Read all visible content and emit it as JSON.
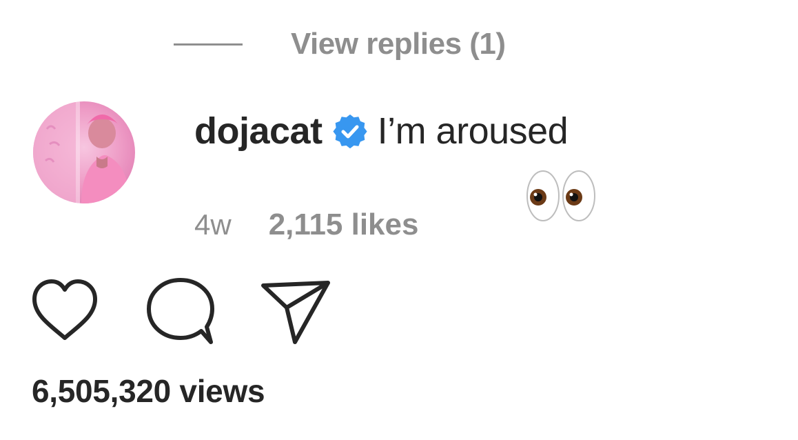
{
  "replies": {
    "view_label": "View replies (1)"
  },
  "comment": {
    "username": "dojacat",
    "verified_icon": "verified-badge-icon",
    "text": "I’m aroused",
    "emoji": "👀",
    "time": "4w",
    "likes": "2,115 likes"
  },
  "actions": {
    "like_icon": "heart-icon",
    "comment_icon": "comment-bubble-icon",
    "share_icon": "paper-plane-icon"
  },
  "post": {
    "views": "6,505,320 views"
  },
  "colors": {
    "text_primary": "#262626",
    "text_secondary": "#8e8e8e",
    "verified_blue": "#3897f0",
    "avatar_pink": "#f0a6cc"
  }
}
